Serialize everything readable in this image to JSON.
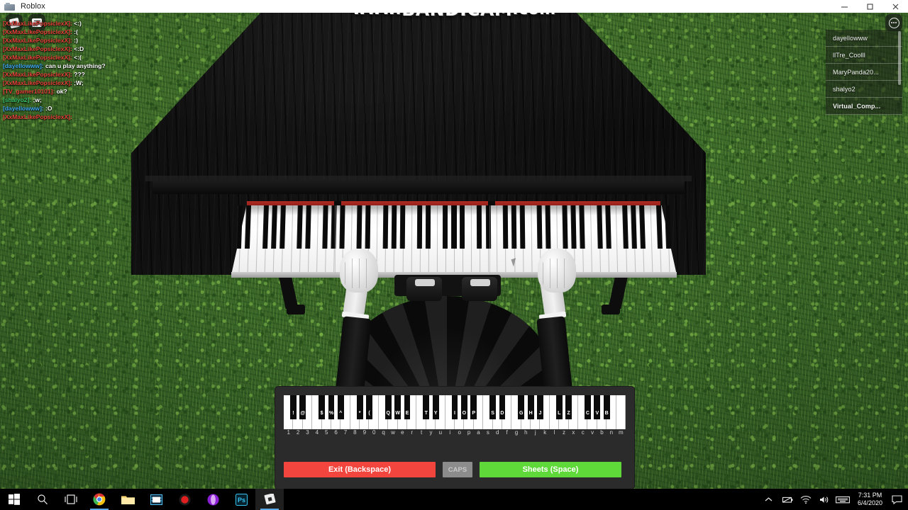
{
  "window": {
    "title": "Roblox",
    "icon": "roblox-window-icon",
    "minimize": "–",
    "maximize": "❐",
    "close": "✕"
  },
  "watermark": {
    "prefix": "www.",
    "brand": "BANDICAM",
    "suffix": ".com"
  },
  "roblox_topbar": {
    "left_buttons": [
      {
        "name": "roblox-menu-button",
        "icon": "roblox-logo-icon"
      },
      {
        "name": "chat-toggle-button",
        "icon": "chat-bubble-icon"
      }
    ],
    "right_button": {
      "name": "more-menu-button",
      "icon": "three-dots-circle-icon"
    }
  },
  "chat": {
    "lines": [
      {
        "name": "[XxMaxLikePopsiclexX]:",
        "color": "#e8423a",
        "message": "<:)"
      },
      {
        "name": "[XxMaxLikePopsiclexX]:",
        "color": "#e8423a",
        "message": ":("
      },
      {
        "name": "[XxMaxLikePopsiclexX]:",
        "color": "#e8423a",
        "message": ":)"
      },
      {
        "name": "[XxMaxLikePopsiclexX]:",
        "color": "#e8423a",
        "message": "<:D"
      },
      {
        "name": "[XxMaxLikePopsiclexX]:",
        "color": "#e8423a",
        "message": "<:("
      },
      {
        "name": "[dayellowww]:",
        "color": "#3fa9f5",
        "message": "can u play anything?"
      },
      {
        "name": "[XxMaxLikePopsiclexX]:",
        "color": "#e8423a",
        "message": "???"
      },
      {
        "name": "[XxMaxLikePopsiclexX]:",
        "color": "#e8423a",
        "message": ";W;"
      },
      {
        "name": "[TV_gamer10101]:",
        "color": "#e8423a",
        "message": "ok?"
      },
      {
        "name": "[shalyo2]:",
        "color": "#39c46e",
        "message": ";w;"
      },
      {
        "name": "[dayellowww]:",
        "color": "#3fa9f5",
        "message": ":O"
      },
      {
        "name": "[XxMaxLikePopsiclexX]:",
        "color": "#e8423a",
        "message": "___"
      }
    ]
  },
  "player_list": {
    "players": [
      {
        "name": "dayellowww",
        "is_local": false
      },
      {
        "name": "llTre_Coolll",
        "is_local": false
      },
      {
        "name": "MaryPanda20...",
        "is_local": false
      },
      {
        "name": "shalyo2",
        "is_local": false
      },
      {
        "name": "Virtual_Comp...",
        "is_local": true
      }
    ]
  },
  "piano_overlay": {
    "white_keys": [
      "1",
      "2",
      "3",
      "4",
      "5",
      "6",
      "7",
      "8",
      "9",
      "0",
      "q",
      "w",
      "e",
      "r",
      "t",
      "y",
      "u",
      "i",
      "o",
      "p",
      "a",
      "s",
      "d",
      "f",
      "g",
      "h",
      "j",
      "k",
      "l",
      "z",
      "x",
      "c",
      "v",
      "b",
      "n",
      "m"
    ],
    "black_keys": [
      "!",
      "@",
      "$",
      "%",
      "^",
      "*",
      "(",
      "Q",
      "W",
      "E",
      "T",
      "Y",
      "I",
      "O",
      "P",
      "S",
      "D",
      "G",
      "H",
      "J",
      "L",
      "Z",
      "C",
      "V",
      "B"
    ],
    "buttons": {
      "exit": {
        "label": "Exit (Backspace)",
        "color": "#f1453d"
      },
      "caps": {
        "label": "CAPS",
        "color": "#8c8c8c"
      },
      "sheets": {
        "label": "Sheets (Space)",
        "color": "#5fd83a"
      }
    }
  },
  "taskbar": {
    "items": [
      {
        "name": "start-button",
        "icon": "windows-logo-icon",
        "state": "idle"
      },
      {
        "name": "search-button",
        "icon": "search-icon",
        "state": "idle"
      },
      {
        "name": "task-view-button",
        "icon": "task-view-icon",
        "state": "idle"
      },
      {
        "name": "chrome-taskbar-button",
        "icon": "chrome-icon",
        "state": "open"
      },
      {
        "name": "file-explorer-taskbar-button",
        "icon": "folder-icon",
        "state": "idle"
      },
      {
        "name": "bandicam-taskbar-button",
        "icon": "bandicam-icon",
        "state": "idle"
      },
      {
        "name": "recorder-taskbar-button",
        "icon": "record-circle-icon",
        "state": "idle"
      },
      {
        "name": "opera-taskbar-button",
        "icon": "opera-icon",
        "state": "idle"
      },
      {
        "name": "photoshop-taskbar-button",
        "icon": "photoshop-icon",
        "state": "idle"
      },
      {
        "name": "roblox-taskbar-button",
        "icon": "roblox-icon",
        "state": "active"
      }
    ],
    "tray": [
      {
        "name": "show-hidden-icons-button",
        "icon": "chevron-up-icon"
      },
      {
        "name": "battery-tray-icon",
        "icon": "battery-icon"
      },
      {
        "name": "network-tray-icon",
        "icon": "wifi-icon"
      },
      {
        "name": "volume-tray-icon",
        "icon": "speaker-icon"
      },
      {
        "name": "keyboard-tray-icon",
        "icon": "keyboard-icon"
      }
    ],
    "clock": {
      "time": "7:31 PM",
      "date": "6/4/2020"
    },
    "action_center": {
      "name": "action-center-button",
      "icon": "speech-bubble-icon"
    }
  }
}
